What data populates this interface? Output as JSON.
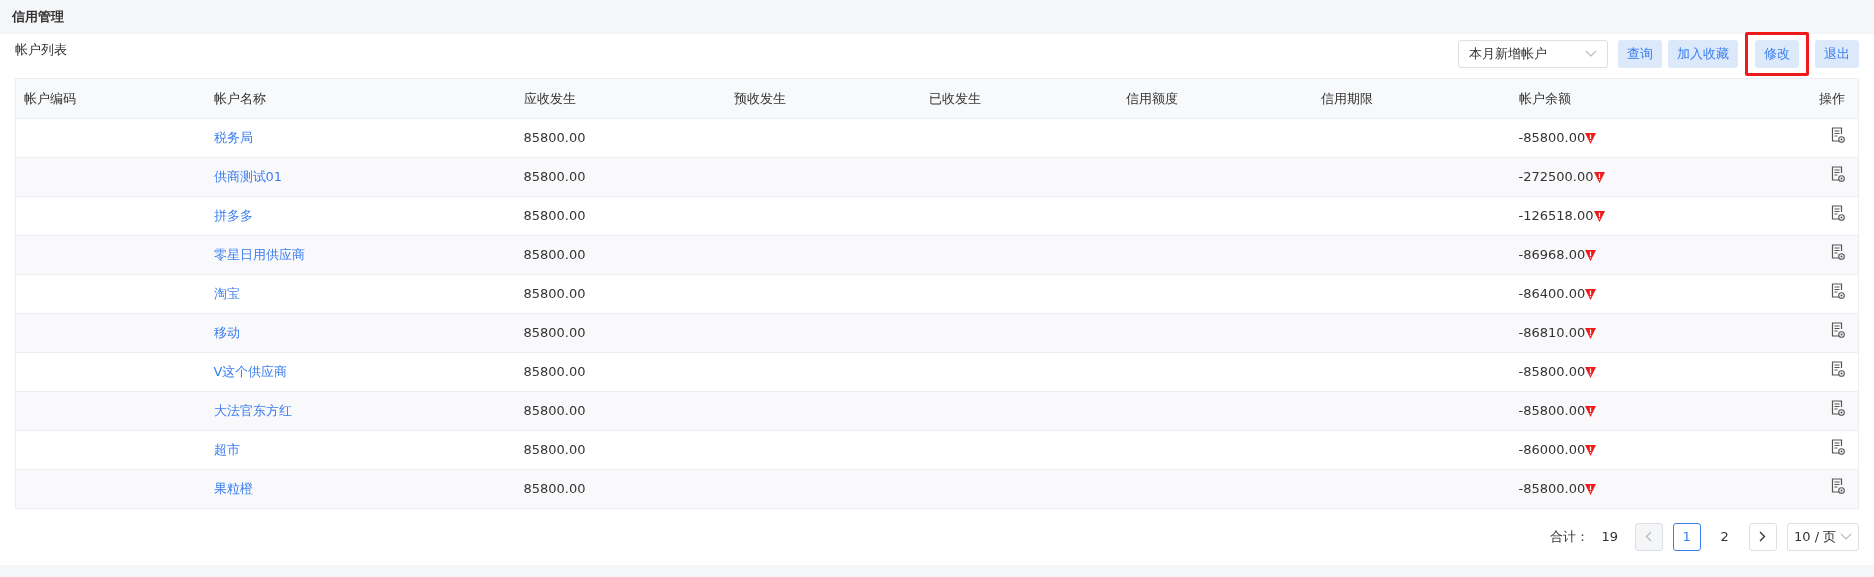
{
  "page_title": "信用管理",
  "section_title": "帐户列表",
  "filter": {
    "value": "本月新增帐户"
  },
  "toolbar_buttons": [
    {
      "label": "查询",
      "highlighted": false
    },
    {
      "label": "加入收藏",
      "highlighted": false
    },
    {
      "label": "修改",
      "highlighted": true
    },
    {
      "label": "退出",
      "highlighted": false
    }
  ],
  "table": {
    "columns": [
      "帐户编码",
      "帐户名称",
      "应收发生",
      "预收发生",
      "已收发生",
      "信用额度",
      "信用期限",
      "帐户余额",
      "操作"
    ],
    "rows": [
      {
        "name": "税务局",
        "receivable": "85800.00",
        "balance": "-85800.00",
        "alert": true
      },
      {
        "name": "供商测试01",
        "receivable": "85800.00",
        "balance": "-272500.00",
        "alert": true
      },
      {
        "name": "拼多多",
        "receivable": "85800.00",
        "balance": "-126518.00",
        "alert": true
      },
      {
        "name": "零星日用供应商",
        "receivable": "85800.00",
        "balance": "-86968.00",
        "alert": true
      },
      {
        "name": "淘宝",
        "receivable": "85800.00",
        "balance": "-86400.00",
        "alert": true
      },
      {
        "name": "移动",
        "receivable": "85800.00",
        "balance": "-86810.00",
        "alert": true
      },
      {
        "name": "V这个供应商",
        "receivable": "85800.00",
        "balance": "-85800.00",
        "alert": true
      },
      {
        "name": "大法官东方红",
        "receivable": "85800.00",
        "balance": "-85800.00",
        "alert": true
      },
      {
        "name": "超市",
        "receivable": "85800.00",
        "balance": "-86000.00",
        "alert": true
      },
      {
        "name": "果粒橙",
        "receivable": "85800.00",
        "balance": "-85800.00",
        "alert": true
      }
    ]
  },
  "pagination": {
    "total_label": "合计：",
    "total": "19",
    "prev_disabled": true,
    "pages": [
      {
        "label": "1",
        "selected": true
      },
      {
        "label": "2",
        "selected": false
      }
    ],
    "page_size": "10 / 页"
  }
}
